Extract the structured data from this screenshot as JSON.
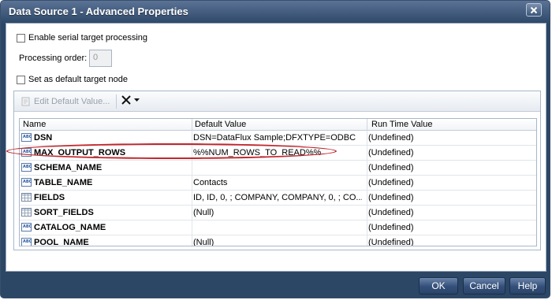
{
  "window": {
    "title": "Data Source 1 - Advanced Properties"
  },
  "options": {
    "serial_label": "Enable serial target processing",
    "serial_checked": false,
    "processing_order_label": "Processing order:",
    "processing_order_value": "0",
    "default_target_label": "Set as default target node",
    "default_target_checked": false
  },
  "toolbar": {
    "edit_default_label": "Edit Default Value...",
    "delete_icon": "x-icon"
  },
  "grid": {
    "columns": [
      "Name",
      "Default Value",
      "Run Time Value"
    ],
    "rows": [
      {
        "icon": "abc",
        "name": "DSN",
        "default": "DSN=DataFlux Sample;DFXTYPE=ODBC",
        "runtime": "(Undefined)"
      },
      {
        "icon": "abc",
        "name": "MAX_OUTPUT_ROWS",
        "default": "%%NUM_ROWS_TO_READ%%",
        "runtime": "(Undefined)"
      },
      {
        "icon": "abc",
        "name": "SCHEMA_NAME",
        "default": "",
        "runtime": "(Undefined)"
      },
      {
        "icon": "abc",
        "name": "TABLE_NAME",
        "default": "Contacts",
        "runtime": "(Undefined)"
      },
      {
        "icon": "grid",
        "name": "FIELDS",
        "default": "ID, ID, 0, ; COMPANY, COMPANY, 0, ; CO...",
        "runtime": "(Undefined)"
      },
      {
        "icon": "grid",
        "name": "SORT_FIELDS",
        "default": "(Null)",
        "runtime": "(Undefined)"
      },
      {
        "icon": "abc",
        "name": "CATALOG_NAME",
        "default": "",
        "runtime": "(Undefined)"
      },
      {
        "icon": "abc",
        "name": "POOL_NAME",
        "default": "(Null)",
        "runtime": "(Undefined)"
      }
    ]
  },
  "buttons": {
    "ok": "OK",
    "cancel": "Cancel",
    "help": "Help"
  },
  "colors": {
    "title_bar": "#2c4666",
    "highlight_oval": "#c1272d"
  }
}
